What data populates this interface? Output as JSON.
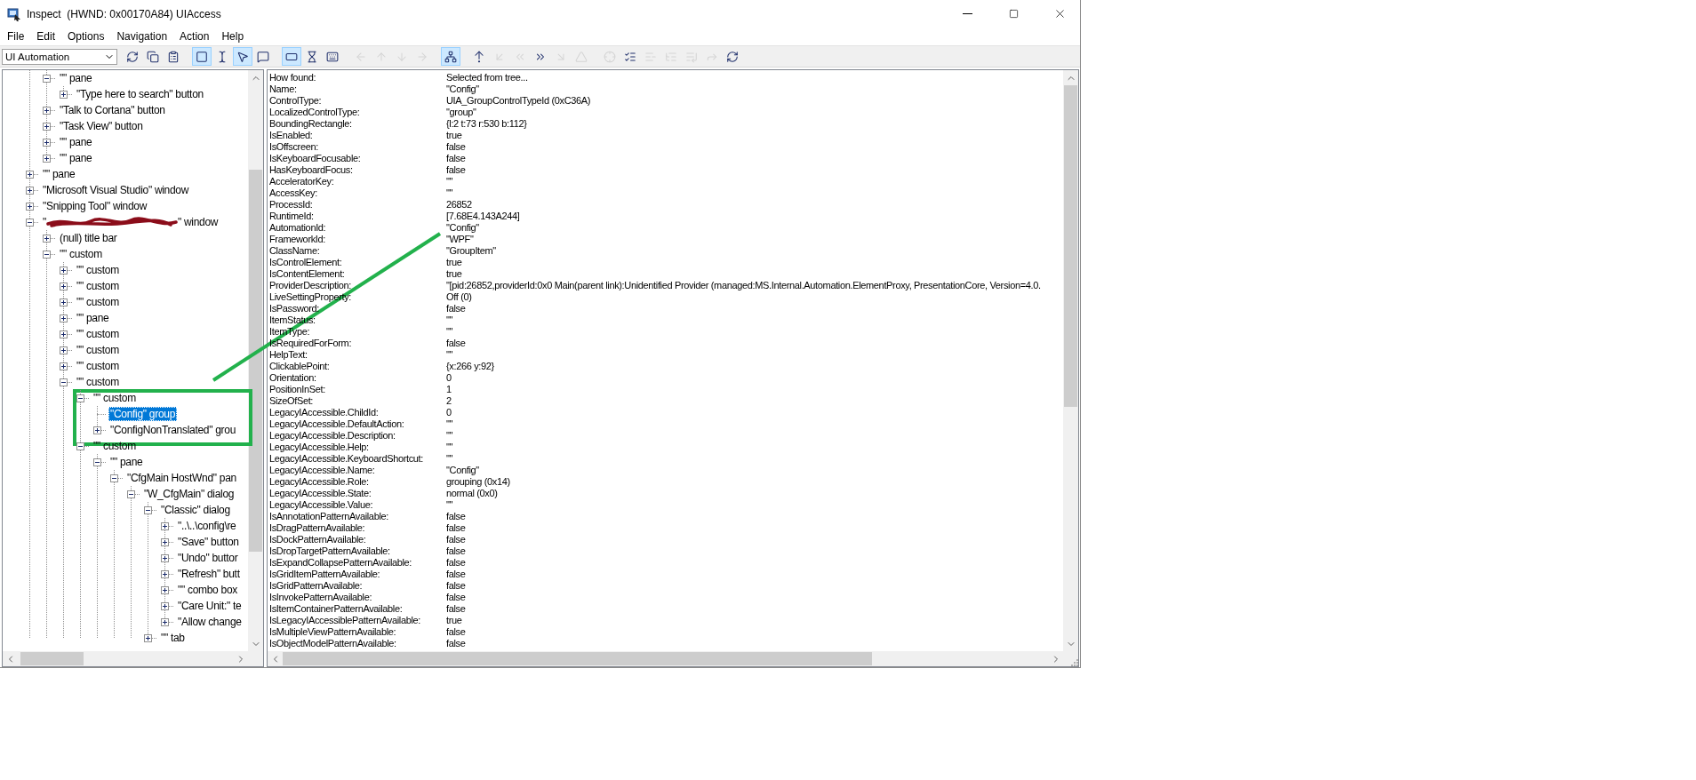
{
  "window": {
    "title": "Inspect  (HWND: 0x00170A84) UIAccess"
  },
  "menu": [
    {
      "label": "File"
    },
    {
      "label": "Edit"
    },
    {
      "label": "Options"
    },
    {
      "label": "Navigation"
    },
    {
      "label": "Action"
    },
    {
      "label": "Help"
    }
  ],
  "toolbar": {
    "mode_select": {
      "value": "UI Automation"
    },
    "groups": [
      [
        {
          "kind": "refresh",
          "selected": false,
          "disabled": false
        },
        {
          "kind": "copy",
          "selected": false,
          "disabled": false
        },
        {
          "kind": "properties",
          "selected": false,
          "disabled": false
        }
      ],
      [
        {
          "kind": "rectangle",
          "selected": true,
          "disabled": false
        },
        {
          "kind": "text-cursor",
          "selected": false,
          "disabled": false
        },
        {
          "kind": "pointer",
          "selected": true,
          "disabled": false
        },
        {
          "kind": "tooltip",
          "selected": false,
          "disabled": false
        }
      ],
      [
        {
          "kind": "focus",
          "selected": true,
          "disabled": false
        },
        {
          "kind": "hourglass",
          "selected": false,
          "disabled": false
        },
        {
          "kind": "keyboard",
          "selected": false,
          "disabled": false
        }
      ],
      [
        {
          "kind": "arrow-left",
          "selected": false,
          "disabled": true
        },
        {
          "kind": "arrow-up",
          "selected": false,
          "disabled": true
        },
        {
          "kind": "arrow-down",
          "selected": false,
          "disabled": true
        },
        {
          "kind": "arrow-right",
          "selected": false,
          "disabled": true
        }
      ],
      [
        {
          "kind": "tree",
          "selected": true,
          "disabled": false
        }
      ],
      [
        {
          "kind": "parent",
          "selected": false,
          "disabled": false
        },
        {
          "kind": "first-child",
          "selected": false,
          "disabled": true
        },
        {
          "kind": "previous",
          "selected": false,
          "disabled": true
        },
        {
          "kind": "next",
          "selected": false,
          "disabled": false
        },
        {
          "kind": "last-child",
          "selected": false,
          "disabled": true
        },
        {
          "kind": "root",
          "selected": false,
          "disabled": true
        }
      ],
      [
        {
          "kind": "pick",
          "selected": false,
          "disabled": true
        },
        {
          "kind": "mark",
          "selected": false,
          "disabled": false
        },
        {
          "kind": "collapse",
          "selected": false,
          "disabled": true
        },
        {
          "kind": "list",
          "selected": false,
          "disabled": true
        },
        {
          "kind": "list-end",
          "selected": false,
          "disabled": true
        },
        {
          "kind": "forward",
          "selected": false,
          "disabled": true
        },
        {
          "kind": "refresh",
          "selected": false,
          "disabled": false
        }
      ]
    ]
  },
  "tree": {
    "nodes": [
      {
        "kind": "continuation",
        "children": [
          {
            "kind": "branch",
            "label": "\"\" pane",
            "expanded": true,
            "selected": false,
            "children": [
              {
                "kind": "branch",
                "label": "\"Type here to search\" button",
                "expanded": false,
                "selected": false
              }
            ]
          },
          {
            "kind": "branch",
            "label": "\"Talk to Cortana\" button",
            "expanded": false,
            "selected": false
          },
          {
            "kind": "branch",
            "label": "\"Task View\" button",
            "expanded": false,
            "selected": false
          },
          {
            "kind": "branch",
            "label": "\"\" pane",
            "expanded": false,
            "selected": false
          },
          {
            "kind": "branch",
            "label": "\"\" pane",
            "expanded": false,
            "selected": false
          }
        ]
      },
      {
        "kind": "branch",
        "label": "\"\" pane",
        "expanded": false,
        "selected": false
      },
      {
        "kind": "branch",
        "label": "\"Microsoft Visual Studio\" window",
        "expanded": false,
        "selected": false
      },
      {
        "kind": "branch",
        "label": "\"Snipping Tool\" window",
        "expanded": false,
        "selected": false
      },
      {
        "kind": "branch",
        "prefix": "\"",
        "label": "\" window",
        "redacted": true,
        "expanded": true,
        "selected": false,
        "children": [
          {
            "kind": "branch",
            "label": "(null) title bar",
            "expanded": false,
            "selected": false
          },
          {
            "kind": "branch",
            "label": "\"\" custom",
            "expanded": true,
            "selected": false,
            "children": [
              {
                "kind": "branch",
                "label": "\"\" custom",
                "expanded": false,
                "selected": false
              },
              {
                "kind": "branch",
                "label": "\"\" custom",
                "expanded": false,
                "selected": false
              },
              {
                "kind": "branch",
                "label": "\"\" custom",
                "expanded": false,
                "selected": false
              },
              {
                "kind": "branch",
                "label": "\"\" pane",
                "expanded": false,
                "selected": false
              },
              {
                "kind": "branch",
                "label": "\"\" custom",
                "expanded": false,
                "selected": false
              },
              {
                "kind": "branch",
                "label": "\"\" custom",
                "expanded": false,
                "selected": false
              },
              {
                "kind": "branch",
                "label": "\"\" custom",
                "expanded": false,
                "selected": false
              },
              {
                "kind": "branch",
                "label": "\"\" custom",
                "expanded": true,
                "selected": false,
                "children": [
                  {
                    "kind": "branch",
                    "label": "\"\" custom",
                    "expanded": true,
                    "selected": false,
                    "children": [
                      {
                        "kind": "leaf",
                        "label": "\"Config\" group",
                        "selected": true
                      },
                      {
                        "kind": "branch",
                        "label": "\"ConfigNonTranslated\" grou",
                        "expanded": false,
                        "selected": false
                      }
                    ]
                  },
                  {
                    "kind": "branch",
                    "label": "\"\" custom",
                    "expanded": true,
                    "selected": false,
                    "children": [
                      {
                        "kind": "branch",
                        "label": "\"\" pane",
                        "expanded": true,
                        "selected": false,
                        "children": [
                          {
                            "kind": "branch",
                            "label": "\"CfgMain HostWnd\" pan",
                            "expanded": true,
                            "selected": false,
                            "children": [
                              {
                                "kind": "branch",
                                "label": "\"W_CfgMain\" dialog",
                                "expanded": true,
                                "selected": false,
                                "children": [
                                  {
                                    "kind": "branch",
                                    "label": "\"Classic\" dialog",
                                    "expanded": true,
                                    "selected": false,
                                    "children": [
                                      {
                                        "kind": "branch",
                                        "label": "\"..\\..\\config\\re",
                                        "expanded": false,
                                        "selected": false
                                      },
                                      {
                                        "kind": "branch",
                                        "label": "\"Save\" button",
                                        "expanded": false,
                                        "selected": false
                                      },
                                      {
                                        "kind": "branch",
                                        "label": "\"Undo\" buttor",
                                        "expanded": false,
                                        "selected": false
                                      },
                                      {
                                        "kind": "branch",
                                        "label": "\"Refresh\" butt",
                                        "expanded": false,
                                        "selected": false
                                      },
                                      {
                                        "kind": "branch",
                                        "label": "\"\" combo box",
                                        "expanded": false,
                                        "selected": false
                                      },
                                      {
                                        "kind": "branch",
                                        "label": "\"Care Unit:\" te",
                                        "expanded": false,
                                        "selected": false
                                      },
                                      {
                                        "kind": "branch",
                                        "label": "\"Allow change",
                                        "expanded": false,
                                        "selected": false
                                      }
                                    ]
                                  },
                                  {
                                    "kind": "branch",
                                    "label": "\"\" tab",
                                    "expanded": false,
                                    "selected": false
                                  }
                                ]
                              }
                            ]
                          }
                        ]
                      }
                    ]
                  }
                ]
              }
            ]
          }
        ]
      }
    ]
  },
  "properties": [
    {
      "name": "How found:",
      "value": "Selected from tree..."
    },
    {
      "name": "Name:",
      "value": "\"Config\""
    },
    {
      "name": "ControlType:",
      "value": "UIA_GroupControlTypeId (0xC36A)"
    },
    {
      "name": "LocalizedControlType:",
      "value": "\"group\""
    },
    {
      "name": "BoundingRectangle:",
      "value": "{l:2 t:73 r:530 b:112}"
    },
    {
      "name": "IsEnabled:",
      "value": "true"
    },
    {
      "name": "IsOffscreen:",
      "value": "false"
    },
    {
      "name": "IsKeyboardFocusable:",
      "value": "false"
    },
    {
      "name": "HasKeyboardFocus:",
      "value": "false"
    },
    {
      "name": "AcceleratorKey:",
      "value": "\"\""
    },
    {
      "name": "AccessKey:",
      "value": "\"\""
    },
    {
      "name": "ProcessId:",
      "value": "26852"
    },
    {
      "name": "RuntimeId:",
      "value": "[7.68E4.143A244]"
    },
    {
      "name": "AutomationId:",
      "value": "\"Config\""
    },
    {
      "name": "FrameworkId:",
      "value": "\"WPF\""
    },
    {
      "name": "ClassName:",
      "value": "\"GroupItem\""
    },
    {
      "name": "IsControlElement:",
      "value": "true"
    },
    {
      "name": "IsContentElement:",
      "value": "true"
    },
    {
      "name": "ProviderDescription:",
      "value": "\"[pid:26852,providerId:0x0 Main(parent link):Unidentified Provider (managed:MS.Internal.Automation.ElementProxy, PresentationCore, Version=4.0."
    },
    {
      "name": "LiveSettingProperty:",
      "value": "Off (0)"
    },
    {
      "name": "IsPassword:",
      "value": "false"
    },
    {
      "name": "ItemStatus:",
      "value": "\"\""
    },
    {
      "name": "ItemType:",
      "value": "\"\""
    },
    {
      "name": "IsRequiredForForm:",
      "value": "false"
    },
    {
      "name": "HelpText:",
      "value": "\"\""
    },
    {
      "name": "ClickablePoint:",
      "value": "{x:266 y:92}"
    },
    {
      "name": "Orientation:",
      "value": "0"
    },
    {
      "name": "PositionInSet:",
      "value": "1"
    },
    {
      "name": "SizeOfSet:",
      "value": "2"
    },
    {
      "name": "LegacyIAccessible.ChildId:",
      "value": "0"
    },
    {
      "name": "LegacyIAccessible.DefaultAction:",
      "value": "\"\""
    },
    {
      "name": "LegacyIAccessible.Description:",
      "value": "\"\""
    },
    {
      "name": "LegacyIAccessible.Help:",
      "value": "\"\""
    },
    {
      "name": "LegacyIAccessible.KeyboardShortcut:",
      "value": "\"\""
    },
    {
      "name": "LegacyIAccessible.Name:",
      "value": "\"Config\""
    },
    {
      "name": "LegacyIAccessible.Role:",
      "value": "grouping (0x14)"
    },
    {
      "name": "LegacyIAccessible.State:",
      "value": "normal (0x0)"
    },
    {
      "name": "LegacyIAccessible.Value:",
      "value": "\"\""
    },
    {
      "name": "IsAnnotationPatternAvailable:",
      "value": "false"
    },
    {
      "name": "IsDragPatternAvailable:",
      "value": "false"
    },
    {
      "name": "IsDockPatternAvailable:",
      "value": "false"
    },
    {
      "name": "IsDropTargetPatternAvailable:",
      "value": "false"
    },
    {
      "name": "IsExpandCollapsePatternAvailable:",
      "value": "false"
    },
    {
      "name": "IsGridItemPatternAvailable:",
      "value": "false"
    },
    {
      "name": "IsGridPatternAvailable:",
      "value": "false"
    },
    {
      "name": "IsInvokePatternAvailable:",
      "value": "false"
    },
    {
      "name": "IsItemContainerPatternAvailable:",
      "value": "false"
    },
    {
      "name": "IsLegacyIAccessiblePatternAvailable:",
      "value": "true"
    },
    {
      "name": "IsMultipleViewPatternAvailable:",
      "value": "false"
    },
    {
      "name": "IsObjectModelPatternAvailable:",
      "value": "false"
    }
  ],
  "annotations": {
    "connector_line": true,
    "highlight_frame": true
  }
}
